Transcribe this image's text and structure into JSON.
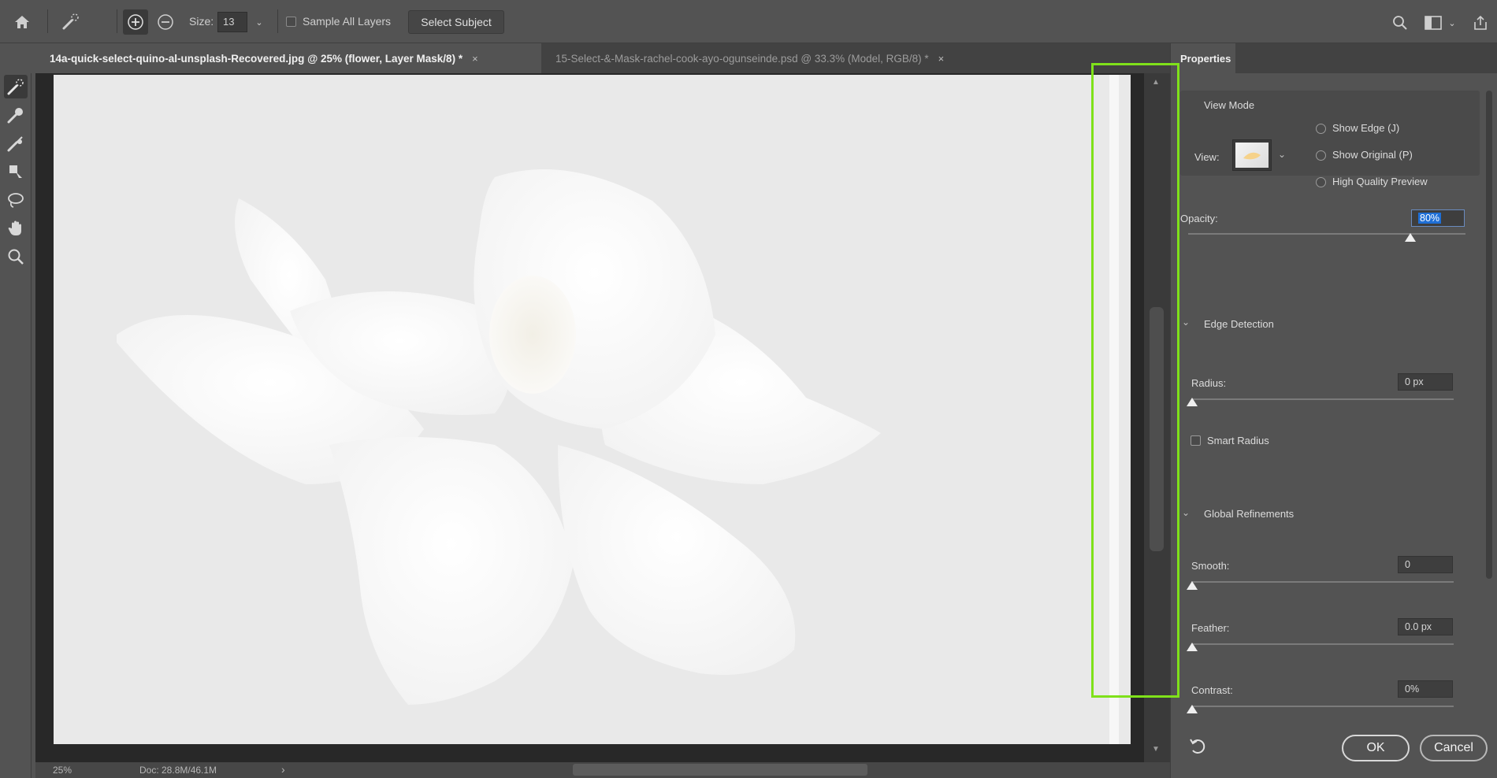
{
  "options_bar": {
    "size_label": "Size:",
    "size_value": "13",
    "sample_all_layers_label": "Sample All Layers",
    "select_subject_label": "Select Subject"
  },
  "tabs": [
    {
      "label": "14a-quick-select-quino-al-unsplash-Recovered.jpg @ 25% (flower, Layer Mask/8) *",
      "close": "×"
    },
    {
      "label": "15-Select-&-Mask-rachel-cook-ayo-ogunseinde.psd @ 33.3% (Model, RGB/8) *",
      "close": "×"
    }
  ],
  "status_bar": {
    "zoom": "25%",
    "doc_size": "Doc: 28.8M/46.1M",
    "arrow": "›"
  },
  "properties": {
    "panel_title": "Properties",
    "view_mode_heading": "View Mode",
    "view_label": "View:",
    "show_edge_label": "Show Edge (J)",
    "show_original_label": "Show Original (P)",
    "high_quality_label": "High Quality Preview",
    "opacity_label": "Opacity:",
    "opacity_value": "80%",
    "opacity_fraction": 0.8,
    "edge_detection_heading": "Edge Detection",
    "radius_label": "Radius:",
    "radius_value": "0 px",
    "smart_radius_label": "Smart Radius",
    "global_refinements_heading": "Global Refinements",
    "smooth_label": "Smooth:",
    "smooth_value": "0",
    "feather_label": "Feather:",
    "feather_value": "0.0 px",
    "contrast_label": "Contrast:",
    "contrast_value": "0%",
    "ok_label": "OK",
    "cancel_label": "Cancel"
  },
  "colors": {
    "highlight": "#7fe11a",
    "canvas_bg": "#e9e9e9",
    "panel_bg": "#535353",
    "selection_blue": "#1f6fd6"
  }
}
